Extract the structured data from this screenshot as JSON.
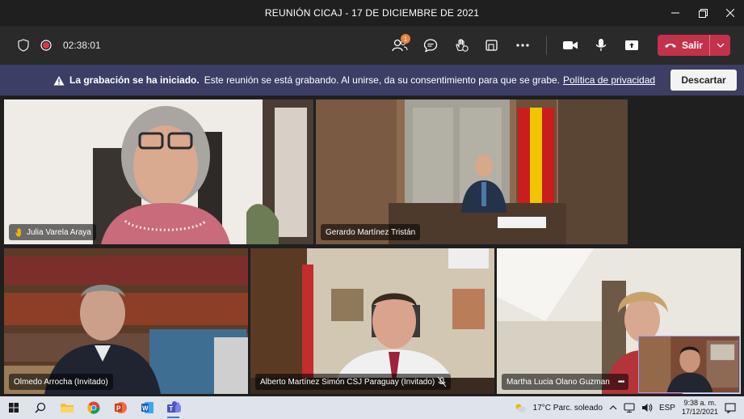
{
  "window": {
    "title": "REUNIÓN CICAJ - 17 DE DICIEMBRE DE 2021"
  },
  "toolbar": {
    "timer": "02:38:01",
    "participants_badge": "1",
    "leave_label": "Salir"
  },
  "banner": {
    "heading": "La grabación se ha iniciado.",
    "message": "Este reunión se está grabando. Al unirse, da su consentimiento para que se grabe.",
    "link": "Política de privacidad",
    "dismiss_label": "Descartar"
  },
  "participants": [
    {
      "name": "Julia Varela Araya",
      "hand_raised": true,
      "active_speaker": true
    },
    {
      "name": "Gerardo Martínez Tristán"
    },
    {
      "name": "Olmedo Arrocha (Invitado)"
    },
    {
      "name": "Alberto Martínez Simón CSJ Paraguay (Invitado)",
      "muted": true
    },
    {
      "name": "Martha Lucia Olano Guzman",
      "more": "•••"
    }
  ],
  "taskbar": {
    "weather": "17°C  Parc. soleado",
    "lang": "ESP",
    "time": "9:38 a. m.",
    "date": "17/12/2021"
  },
  "colors": {
    "leave": "#c4314b",
    "banner": "#3d3e66",
    "active_outline": "#9ea2ff",
    "badge": "#e8813a"
  }
}
